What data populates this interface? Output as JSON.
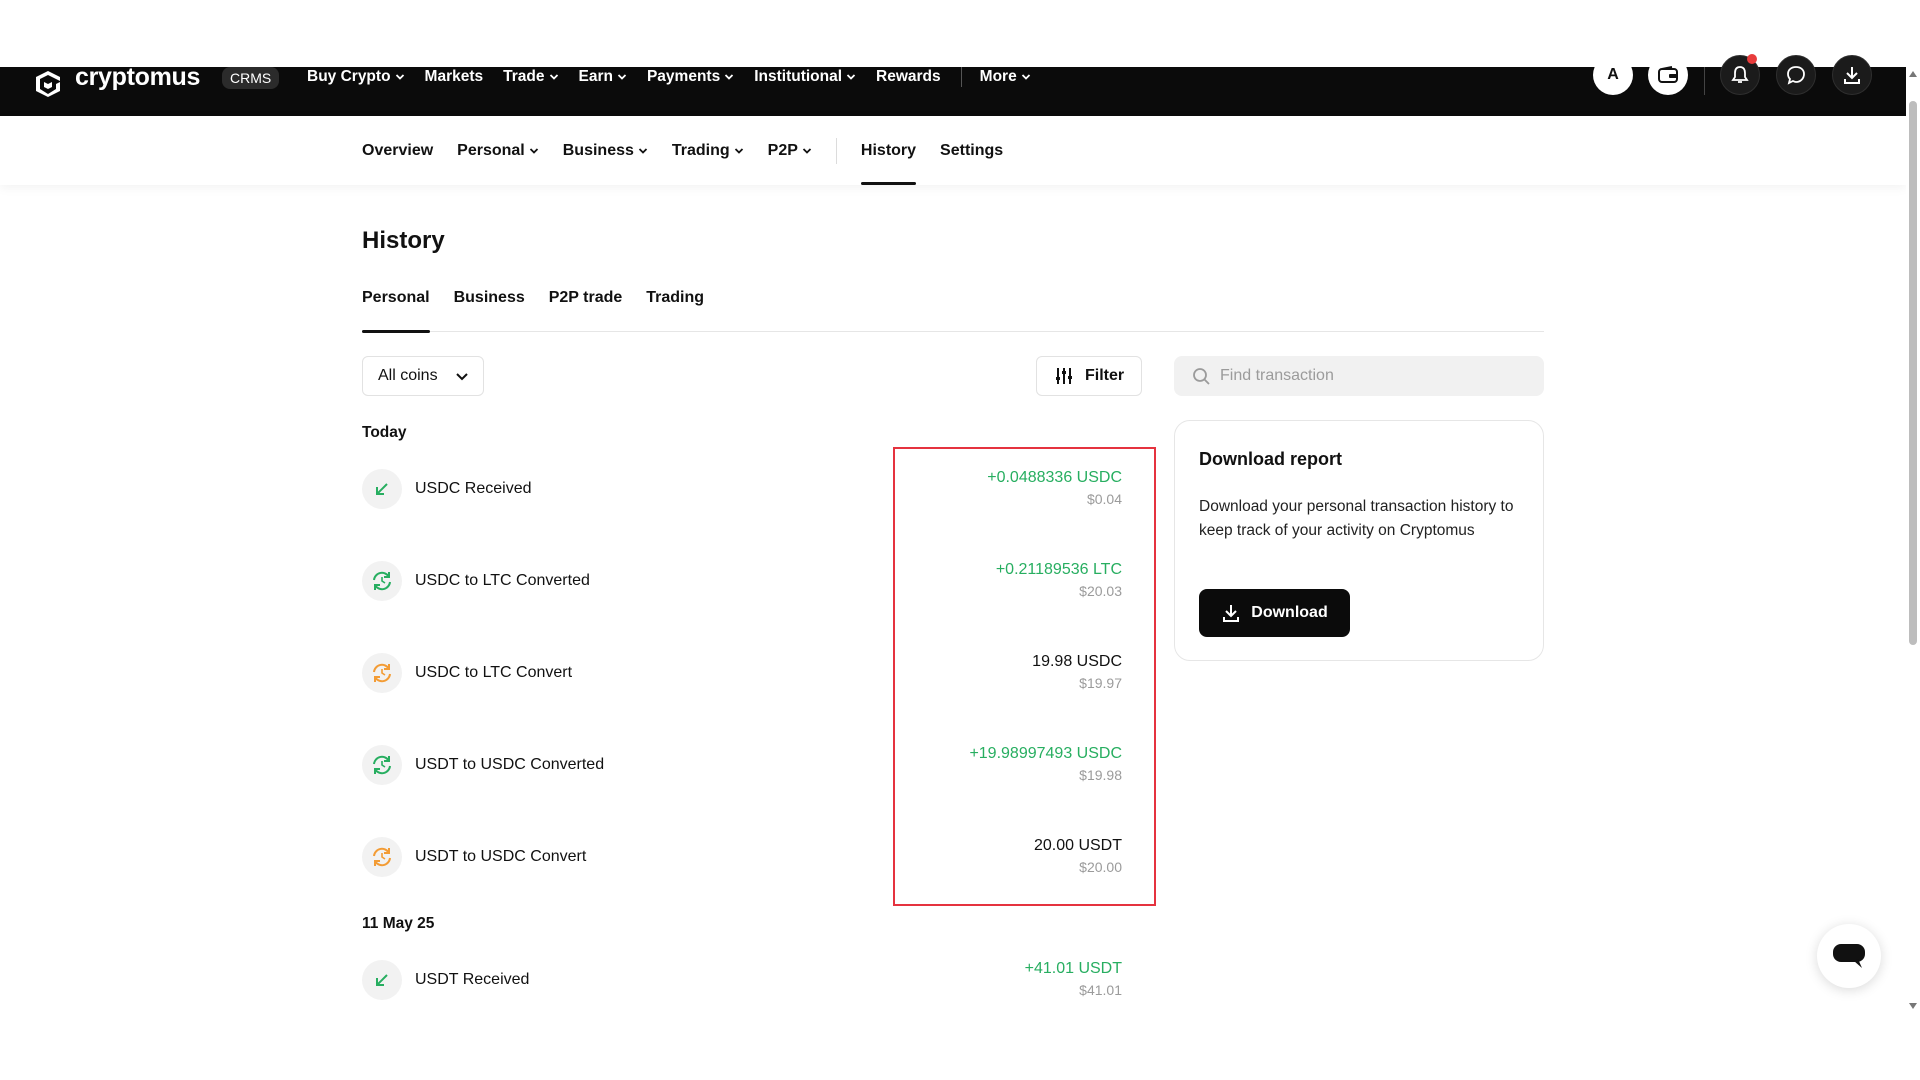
{
  "brand": {
    "name": "cryptomus",
    "badge": "CRMS"
  },
  "topnav": {
    "items": [
      {
        "label": "Buy Crypto",
        "dropdown": true
      },
      {
        "label": "Markets",
        "dropdown": false
      },
      {
        "label": "Trade",
        "dropdown": true
      },
      {
        "label": "Earn",
        "dropdown": true
      },
      {
        "label": "Payments",
        "dropdown": true
      },
      {
        "label": "Institutional",
        "dropdown": true
      },
      {
        "label": "Rewards",
        "dropdown": false
      }
    ],
    "more_label": "More",
    "avatar_letter": "A"
  },
  "subnav": {
    "items": [
      {
        "label": "Overview",
        "dropdown": false
      },
      {
        "label": "Personal",
        "dropdown": true
      },
      {
        "label": "Business",
        "dropdown": true
      },
      {
        "label": "Trading",
        "dropdown": true
      },
      {
        "label": "P2P",
        "dropdown": true
      }
    ],
    "history_label": "History",
    "settings_label": "Settings"
  },
  "page": {
    "title": "History",
    "tabs": [
      "Personal",
      "Business",
      "P2P trade",
      "Trading"
    ],
    "coins_select": "All coins",
    "filter_label": "Filter",
    "search_placeholder": "Find transaction"
  },
  "groups": [
    {
      "day": "Today",
      "transactions": [
        {
          "label": "USDC Received",
          "icon": "received-arrow-icon",
          "amount": "+0.0488336 USDC",
          "usd": "$0.04",
          "amount_color": "green"
        },
        {
          "label": "USDC to LTC Converted",
          "icon": "convert-green-icon",
          "amount": "+0.21189536 LTC",
          "usd": "$20.03",
          "amount_color": "green"
        },
        {
          "label": "USDC to LTC Convert",
          "icon": "convert-orange-icon",
          "amount": "19.98 USDC",
          "usd": "$19.97",
          "amount_color": "dark"
        },
        {
          "label": "USDT to USDC Converted",
          "icon": "convert-green-icon",
          "amount": "+19.98997493 USDC",
          "usd": "$19.98",
          "amount_color": "green"
        },
        {
          "label": "USDT to USDC Convert",
          "icon": "convert-orange-icon",
          "amount": "20.00 USDT",
          "usd": "$20.00",
          "amount_color": "dark"
        }
      ]
    },
    {
      "day": "11 May 25",
      "transactions": [
        {
          "label": "USDT Received",
          "icon": "received-arrow-icon",
          "amount": "+41.01 USDT",
          "usd": "$41.01",
          "amount_color": "green"
        }
      ]
    }
  ],
  "report": {
    "title": "Download report",
    "description": "Download your personal transaction history to keep track of your activity on Cryptomus",
    "button_label": "Download"
  },
  "colors": {
    "green": "#27ae60",
    "highlight": "#e5333f",
    "nav_bg": "#0b0b0b",
    "notification": "#e83c3c"
  }
}
